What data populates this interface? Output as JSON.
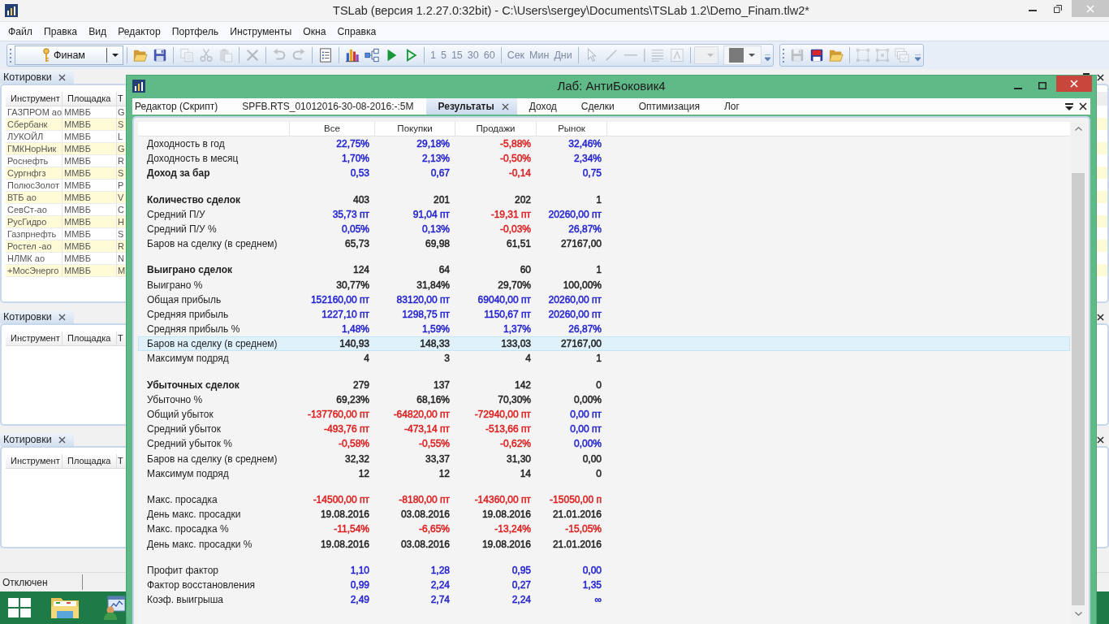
{
  "app": {
    "title": "TSLab (версия 1.2.27.0:32bit) - C:\\Users\\sergey\\Documents\\TSLab 1.2\\Demo_Finam.tlw2*"
  },
  "menu": [
    "Файл",
    "Правка",
    "Вид",
    "Редактор",
    "Портфель",
    "Инструменты",
    "Окна",
    "Справка"
  ],
  "toolbar": {
    "strips": [
      {
        "groups": [
          {
            "items": [
              {
                "kind": "account",
                "label": "Финам",
                "disabled": false
              }
            ]
          },
          {
            "items": [
              {
                "kind": "folder",
                "disabled": false
              },
              {
                "kind": "disk",
                "disabled": false
              }
            ]
          },
          {
            "items": [
              {
                "kind": "copy",
                "disabled": true
              },
              {
                "kind": "scissors",
                "disabled": true
              },
              {
                "kind": "clipboard",
                "disabled": true
              }
            ]
          },
          {
            "items": [
              {
                "kind": "cross",
                "disabled": true
              }
            ]
          },
          {
            "items": [
              {
                "kind": "undo",
                "disabled": true
              },
              {
                "kind": "redo",
                "disabled": true
              }
            ]
          },
          {
            "items": [
              {
                "kind": "sheet",
                "disabled": false
              }
            ]
          },
          {
            "items": [
              {
                "kind": "bars",
                "disabled": false
              },
              {
                "kind": "tree",
                "disabled": false
              },
              {
                "kind": "play",
                "disabled": false
              },
              {
                "kind": "outline",
                "disabled": false
              }
            ]
          },
          {
            "items": [
              {
                "kind": "text",
                "label": "1",
                "disabled": true
              },
              {
                "kind": "text",
                "label": "5",
                "disabled": true
              },
              {
                "kind": "text",
                "label": "15",
                "disabled": true
              },
              {
                "kind": "text",
                "label": "30",
                "disabled": true
              },
              {
                "kind": "text",
                "label": "60",
                "disabled": true
              }
            ]
          },
          {
            "items": [
              {
                "kind": "text",
                "label": "Сек",
                "disabled": true
              },
              {
                "kind": "text",
                "label": "Мин",
                "disabled": true
              },
              {
                "kind": "text",
                "label": "Дни",
                "disabled": true
              }
            ]
          },
          {
            "items": [
              {
                "kind": "pointer",
                "disabled": true
              },
              {
                "kind": "slash",
                "disabled": true
              },
              {
                "kind": "dash",
                "disabled": true
              },
              {
                "kind": "bar",
                "disabled": true
              },
              {
                "kind": "lines",
                "disabled": true
              },
              {
                "kind": "letter",
                "disabled": true
              }
            ]
          },
          {
            "items": [
              {
                "kind": "combo",
                "disabled": true
              },
              {
                "kind": "swatch",
                "disabled": false
              }
            ]
          }
        ]
      },
      {
        "groups": [
          {
            "items": [
              {
                "kind": "disk",
                "disabled": true
              },
              {
                "kind": "badge",
                "disabled": false
              },
              {
                "kind": "folder",
                "disabled": false
              }
            ]
          },
          {
            "items": [
              {
                "kind": "frame",
                "disabled": true
              },
              {
                "kind": "nodes",
                "disabled": true
              },
              {
                "kind": "stack",
                "disabled": true
              }
            ]
          }
        ]
      }
    ]
  },
  "panels": [
    {
      "title": "Котировки",
      "columns": [
        "Инструмент",
        "Площадка",
        "Т"
      ],
      "rows": [
        [
          "ГАЗПРОМ ао",
          "ММВБ",
          "G"
        ],
        [
          "Сбербанк",
          "ММВБ",
          "S"
        ],
        [
          "ЛУКОЙЛ",
          "ММВБ",
          "L"
        ],
        [
          "ГМКНорНик",
          "ММВБ",
          "G"
        ],
        [
          "Роснефть",
          "ММВБ",
          "R"
        ],
        [
          "Сургнфгз",
          "ММВБ",
          "S"
        ],
        [
          "ПолюсЗолот",
          "ММВБ",
          "P"
        ],
        [
          "ВТБ ао",
          "ММВБ",
          "V"
        ],
        [
          "СевСт-ао",
          "ММВБ",
          "C"
        ],
        [
          "РусГидро",
          "ММВБ",
          "H"
        ],
        [
          "Газпрнефть",
          "ММВБ",
          "S"
        ],
        [
          "Ростел -ао",
          "ММВБ",
          "R"
        ],
        [
          "НЛМК ао",
          "ММВБ",
          "N"
        ],
        [
          "+МосЭнерго",
          "ММВБ",
          "M"
        ]
      ]
    },
    {
      "title": "Котировки",
      "columns": [
        "Инструмент",
        "Площадка",
        "Т"
      ]
    },
    {
      "title": "Котировки",
      "columns": [
        "Инструмент",
        "Площадка",
        "Т"
      ]
    }
  ],
  "lab": {
    "title": "Лаб: АнтиБоковик4",
    "tabs": [
      {
        "label": "Редактор (Скрипт)",
        "selected": false
      },
      {
        "label": "SPFB.RTS_01012016-30-08-2016:-:5M",
        "selected": false
      },
      {
        "label": "Результаты",
        "selected": true
      },
      {
        "label": "Доход",
        "selected": false
      },
      {
        "label": "Сделки",
        "selected": false
      },
      {
        "label": "Оптимизация",
        "selected": false
      },
      {
        "label": "Лог",
        "selected": false
      }
    ],
    "table": {
      "columns": [
        "Все",
        "Покупки",
        "Продажи",
        "Рынок"
      ],
      "sections": [
        {
          "rows": [
            {
              "label": "Доходность в год",
              "kind": "metric",
              "selected": false,
              "cells": [
                {
                  "text": "22,75%",
                  "color": "#1f1fcf"
                },
                {
                  "text": "29,18%",
                  "color": "#1f1fcf"
                },
                {
                  "text": "-5,88%",
                  "color": "#dc1e1e"
                },
                {
                  "text": "32,46%",
                  "color": "#1f1fcf"
                }
              ]
            },
            {
              "label": "Доходность в месяц",
              "kind": "metric",
              "selected": false,
              "cells": [
                {
                  "text": "1,70%",
                  "color": "#1f1fcf"
                },
                {
                  "text": "2,13%",
                  "color": "#1f1fcf"
                },
                {
                  "text": "-0,50%",
                  "color": "#dc1e1e"
                },
                {
                  "text": "2,34%",
                  "color": "#1f1fcf"
                }
              ]
            },
            {
              "label": "Доход за бар",
              "kind": "total",
              "selected": false,
              "cells": [
                {
                  "text": "0,53",
                  "color": "#1f1fcf"
                },
                {
                  "text": "0,67",
                  "color": "#1f1fcf"
                },
                {
                  "text": "-0,14",
                  "color": "#dc1e1e"
                },
                {
                  "text": "0,75",
                  "color": "#1f1fcf"
                }
              ]
            }
          ]
        },
        {
          "rows": [
            {
              "label": "Количество сделок",
              "kind": "total",
              "selected": false,
              "cells": [
                {
                  "text": "403",
                  "color": "#222222"
                },
                {
                  "text": "201",
                  "color": "#222222"
                },
                {
                  "text": "202",
                  "color": "#222222"
                },
                {
                  "text": "1",
                  "color": "#222222"
                }
              ]
            },
            {
              "label": "Средний П/У",
              "kind": "metric",
              "selected": false,
              "cells": [
                {
                  "text": "35,73 пт",
                  "color": "#1f1fcf"
                },
                {
                  "text": "91,04 пт",
                  "color": "#1f1fcf"
                },
                {
                  "text": "-19,31 пт",
                  "color": "#dc1e1e"
                },
                {
                  "text": "20260,00 пт",
                  "color": "#1f1fcf"
                }
              ]
            },
            {
              "label": "Средний П/У %",
              "kind": "metric",
              "selected": false,
              "cells": [
                {
                  "text": "0,05%",
                  "color": "#1f1fcf"
                },
                {
                  "text": "0,13%",
                  "color": "#1f1fcf"
                },
                {
                  "text": "-0,03%",
                  "color": "#dc1e1e"
                },
                {
                  "text": "26,87%",
                  "color": "#1f1fcf"
                }
              ]
            },
            {
              "label": "Баров на сделку (в среднем)",
              "kind": "metric",
              "selected": false,
              "cells": [
                {
                  "text": "65,73",
                  "color": "#222222"
                },
                {
                  "text": "69,98",
                  "color": "#222222"
                },
                {
                  "text": "61,51",
                  "color": "#222222"
                },
                {
                  "text": "27167,00",
                  "color": "#222222"
                }
              ]
            }
          ]
        },
        {
          "rows": [
            {
              "label": "Выиграно сделок",
              "kind": "total",
              "selected": false,
              "cells": [
                {
                  "text": "124",
                  "color": "#222222"
                },
                {
                  "text": "64",
                  "color": "#222222"
                },
                {
                  "text": "60",
                  "color": "#222222"
                },
                {
                  "text": "1",
                  "color": "#222222"
                }
              ]
            },
            {
              "label": "Выиграно %",
              "kind": "metric",
              "selected": false,
              "cells": [
                {
                  "text": "30,77%",
                  "color": "#222222"
                },
                {
                  "text": "31,84%",
                  "color": "#222222"
                },
                {
                  "text": "29,70%",
                  "color": "#222222"
                },
                {
                  "text": "100,00%",
                  "color": "#222222"
                }
              ]
            },
            {
              "label": "Общая прибыль",
              "kind": "metric",
              "selected": false,
              "cells": [
                {
                  "text": "152160,00 пт",
                  "color": "#1f1fcf"
                },
                {
                  "text": "83120,00 пт",
                  "color": "#1f1fcf"
                },
                {
                  "text": "69040,00 пт",
                  "color": "#1f1fcf"
                },
                {
                  "text": "20260,00 пт",
                  "color": "#1f1fcf"
                }
              ]
            },
            {
              "label": "Средняя прибыль",
              "kind": "metric",
              "selected": false,
              "cells": [
                {
                  "text": "1227,10 пт",
                  "color": "#1f1fcf"
                },
                {
                  "text": "1298,75 пт",
                  "color": "#1f1fcf"
                },
                {
                  "text": "1150,67 пт",
                  "color": "#1f1fcf"
                },
                {
                  "text": "20260,00 пт",
                  "color": "#1f1fcf"
                }
              ]
            },
            {
              "label": "Средняя прибыль %",
              "kind": "metric",
              "selected": false,
              "cells": [
                {
                  "text": "1,48%",
                  "color": "#1f1fcf"
                },
                {
                  "text": "1,59%",
                  "color": "#1f1fcf"
                },
                {
                  "text": "1,37%",
                  "color": "#1f1fcf"
                },
                {
                  "text": "26,87%",
                  "color": "#1f1fcf"
                }
              ]
            },
            {
              "label": "Баров на сделку (в среднем)",
              "kind": "metric",
              "selected": true,
              "cells": [
                {
                  "text": "140,93",
                  "color": "#222222"
                },
                {
                  "text": "148,33",
                  "color": "#222222"
                },
                {
                  "text": "133,03",
                  "color": "#222222"
                },
                {
                  "text": "27167,00",
                  "color": "#222222"
                }
              ]
            },
            {
              "label": "Максимум подряд",
              "kind": "metric",
              "selected": false,
              "cells": [
                {
                  "text": "4",
                  "color": "#222222"
                },
                {
                  "text": "3",
                  "color": "#222222"
                },
                {
                  "text": "4",
                  "color": "#222222"
                },
                {
                  "text": "1",
                  "color": "#222222"
                }
              ]
            }
          ]
        },
        {
          "rows": [
            {
              "label": "Убыточных сделок",
              "kind": "total",
              "selected": false,
              "cells": [
                {
                  "text": "279",
                  "color": "#222222"
                },
                {
                  "text": "137",
                  "color": "#222222"
                },
                {
                  "text": "142",
                  "color": "#222222"
                },
                {
                  "text": "0",
                  "color": "#222222"
                }
              ]
            },
            {
              "label": "Убыточно %",
              "kind": "metric",
              "selected": false,
              "cells": [
                {
                  "text": "69,23%",
                  "color": "#222222"
                },
                {
                  "text": "68,16%",
                  "color": "#222222"
                },
                {
                  "text": "70,30%",
                  "color": "#222222"
                },
                {
                  "text": "0,00%",
                  "color": "#222222"
                }
              ]
            },
            {
              "label": "Общий убыток",
              "kind": "metric",
              "selected": false,
              "cells": [
                {
                  "text": "-137760,00 пт",
                  "color": "#dc1e1e"
                },
                {
                  "text": "-64820,00 пт",
                  "color": "#dc1e1e"
                },
                {
                  "text": "-72940,00 пт",
                  "color": "#dc1e1e"
                },
                {
                  "text": "0,00 пт",
                  "color": "#1f1fcf"
                }
              ]
            },
            {
              "label": "Средний убыток",
              "kind": "metric",
              "selected": false,
              "cells": [
                {
                  "text": "-493,76 пт",
                  "color": "#dc1e1e"
                },
                {
                  "text": "-473,14 пт",
                  "color": "#dc1e1e"
                },
                {
                  "text": "-513,66 пт",
                  "color": "#dc1e1e"
                },
                {
                  "text": "0,00 пт",
                  "color": "#1f1fcf"
                }
              ]
            },
            {
              "label": "Средний убыток %",
              "kind": "metric",
              "selected": false,
              "cells": [
                {
                  "text": "-0,58%",
                  "color": "#dc1e1e"
                },
                {
                  "text": "-0,55%",
                  "color": "#dc1e1e"
                },
                {
                  "text": "-0,62%",
                  "color": "#dc1e1e"
                },
                {
                  "text": "0,00%",
                  "color": "#1f1fcf"
                }
              ]
            },
            {
              "label": "Баров на сделку (в среднем)",
              "kind": "metric",
              "selected": false,
              "cells": [
                {
                  "text": "32,32",
                  "color": "#222222"
                },
                {
                  "text": "33,37",
                  "color": "#222222"
                },
                {
                  "text": "31,30",
                  "color": "#222222"
                },
                {
                  "text": "0,00",
                  "color": "#222222"
                }
              ]
            },
            {
              "label": "Максимум подряд",
              "kind": "metric",
              "selected": false,
              "cells": [
                {
                  "text": "12",
                  "color": "#222222"
                },
                {
                  "text": "12",
                  "color": "#222222"
                },
                {
                  "text": "14",
                  "color": "#222222"
                },
                {
                  "text": "0",
                  "color": "#222222"
                }
              ]
            }
          ]
        },
        {
          "rows": [
            {
              "label": "Макс. просадка",
              "kind": "metric",
              "selected": false,
              "cells": [
                {
                  "text": "-14500,00 пт",
                  "color": "#dc1e1e"
                },
                {
                  "text": "-8180,00 пт",
                  "color": "#dc1e1e"
                },
                {
                  "text": "-14360,00 пт",
                  "color": "#dc1e1e"
                },
                {
                  "text": "-15050,00 п",
                  "color": "#dc1e1e"
                }
              ]
            },
            {
              "label": "День макс. просадки",
              "kind": "metric",
              "selected": false,
              "cells": [
                {
                  "text": "19.08.2016",
                  "color": "#222222"
                },
                {
                  "text": "03.08.2016",
                  "color": "#222222"
                },
                {
                  "text": "19.08.2016",
                  "color": "#222222"
                },
                {
                  "text": "21.01.2016",
                  "color": "#222222"
                }
              ]
            },
            {
              "label": "Макс. просадка %",
              "kind": "metric",
              "selected": false,
              "cells": [
                {
                  "text": "-11,54%",
                  "color": "#dc1e1e"
                },
                {
                  "text": "-6,65%",
                  "color": "#dc1e1e"
                },
                {
                  "text": "-13,24%",
                  "color": "#dc1e1e"
                },
                {
                  "text": "-15,05%",
                  "color": "#dc1e1e"
                }
              ]
            },
            {
              "label": "День макс. просадки %",
              "kind": "metric",
              "selected": false,
              "cells": [
                {
                  "text": "19.08.2016",
                  "color": "#222222"
                },
                {
                  "text": "03.08.2016",
                  "color": "#222222"
                },
                {
                  "text": "19.08.2016",
                  "color": "#222222"
                },
                {
                  "text": "21.01.2016",
                  "color": "#222222"
                }
              ]
            }
          ]
        },
        {
          "rows": [
            {
              "label": "Профит фактор",
              "kind": "metric",
              "selected": false,
              "cells": [
                {
                  "text": "1,10",
                  "color": "#1f1fcf"
                },
                {
                  "text": "1,28",
                  "color": "#1f1fcf"
                },
                {
                  "text": "0,95",
                  "color": "#1f1fcf"
                },
                {
                  "text": "0,00",
                  "color": "#1f1fcf"
                }
              ]
            },
            {
              "label": "Фактор восстановления",
              "kind": "metric",
              "selected": false,
              "cells": [
                {
                  "text": "0,99",
                  "color": "#1f1fcf"
                },
                {
                  "text": "2,24",
                  "color": "#1f1fcf"
                },
                {
                  "text": "0,27",
                  "color": "#1f1fcf"
                },
                {
                  "text": "1,35",
                  "color": "#1f1fcf"
                }
              ]
            },
            {
              "label": "Коэф. выигрыша",
              "kind": "metric",
              "selected": false,
              "cells": [
                {
                  "text": "2,49",
                  "color": "#1f1fcf"
                },
                {
                  "text": "2,74",
                  "color": "#1f1fcf"
                },
                {
                  "text": "2,24",
                  "color": "#1f1fcf"
                },
                {
                  "text": "∞",
                  "color": "#1f1fcf"
                }
              ]
            }
          ]
        }
      ]
    }
  },
  "status_bar": {
    "text": "Отключен"
  }
}
